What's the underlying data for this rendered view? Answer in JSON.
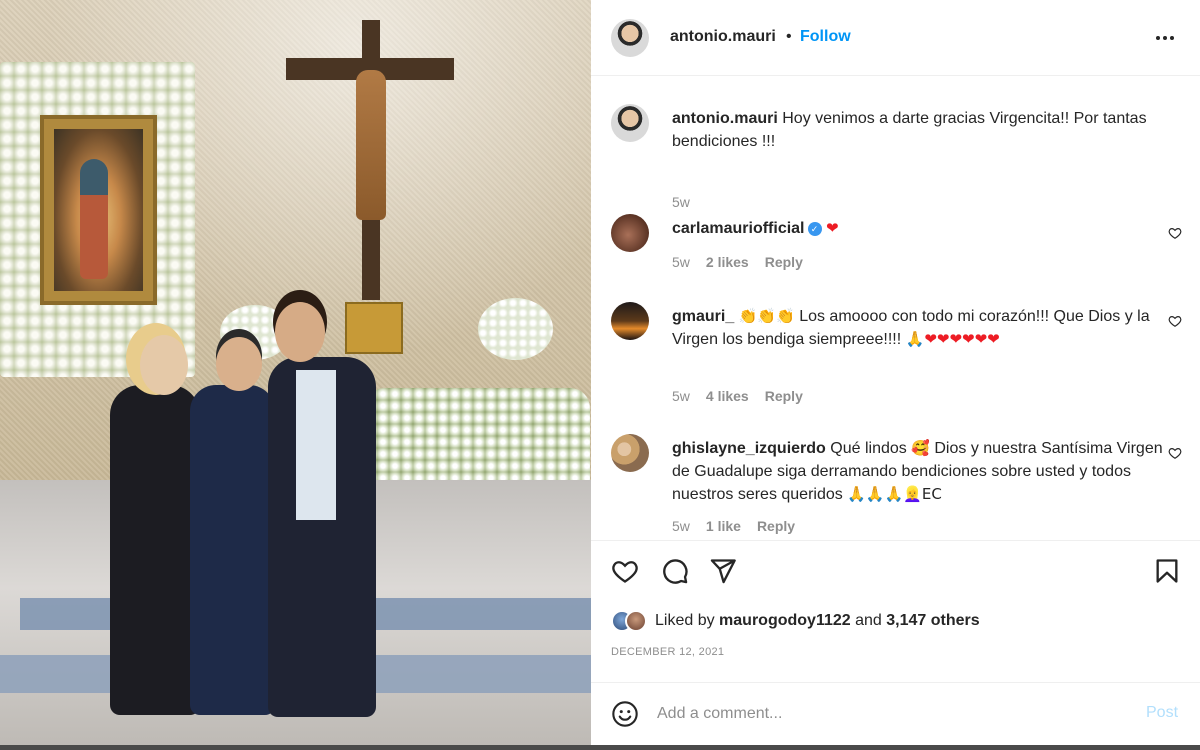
{
  "post": {
    "username": "antonio.mauri",
    "dot": "•",
    "follow_label": "Follow",
    "more_icon": "more-horizontal-icon"
  },
  "caption": {
    "username": "antonio.mauri",
    "text": "Hoy venimos a darte gracias Virgencita!! Por tantas bendiciones !!!",
    "time": "5w"
  },
  "comments": [
    {
      "username": "carlamauriofficial",
      "verified": true,
      "text": "❤",
      "time": "5w",
      "likes": "2 likes",
      "reply": "Reply"
    },
    {
      "username": "gmauri_",
      "emoji_prefix": "👏👏👏",
      "text": "Los amoooo con todo mi corazón!!! Que Dios y la Virgen los bendiga siempreee!!!!",
      "emoji_suffix": "🙏❤❤❤❤❤❤",
      "time": "5w",
      "likes": "4 likes",
      "reply": "Reply"
    },
    {
      "username": "ghislayne_izquierdo",
      "text": "Qué lindos",
      "emoji_mid": "🥰",
      "text2": "Dios y nuestra Santísima Virgen de Guadalupe siga derramando bendiciones sobre usted y todos nuestros seres queridos",
      "emoji_suffix": "🙏🙏🙏👱‍♀️EC",
      "time": "5w",
      "likes": "1 like",
      "reply": "Reply"
    }
  ],
  "actions": {
    "like_icon": "heart-icon",
    "comment_icon": "comment-icon",
    "share_icon": "send-icon",
    "save_icon": "bookmark-icon"
  },
  "likes": {
    "prefix": "Liked by",
    "user": "maurogodoy1122",
    "and": "and",
    "others": "3,147 others"
  },
  "date": "DECEMBER 12, 2021",
  "add_comment": {
    "placeholder": "Add a comment...",
    "post_label": "Post",
    "emoji_icon": "smiley-icon"
  },
  "colors": {
    "follow": "#0095f6",
    "verified": "#3897f0",
    "heart": "#ed1c24",
    "post_disabled": "#b2dffc"
  }
}
